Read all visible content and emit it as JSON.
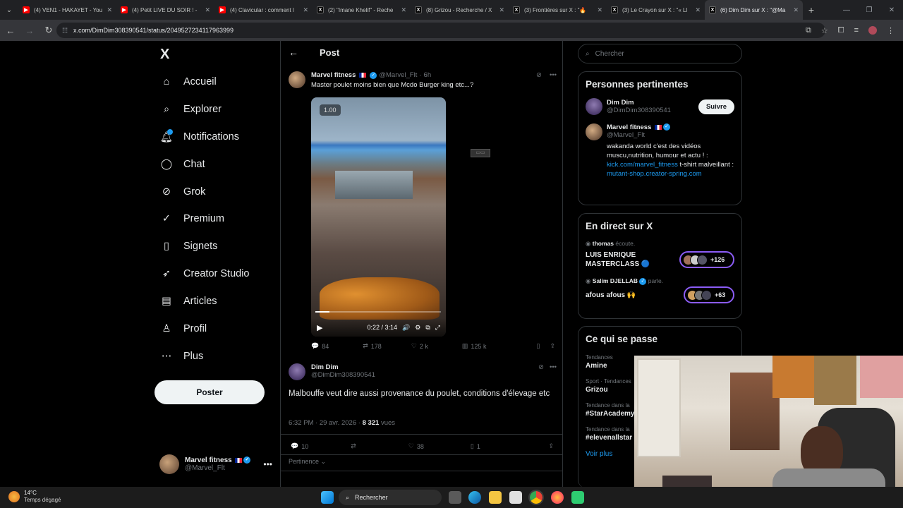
{
  "browser": {
    "tabs": [
      {
        "title": "(4) VEN1 - HAKAYET - You",
        "icon": "youtube",
        "color": "#ff0000"
      },
      {
        "title": "(4) Petit LIVE DU SOIR ! -",
        "icon": "youtube",
        "color": "#ff0000"
      },
      {
        "title": "(4) Clavicular : comment l",
        "icon": "youtube",
        "color": "#ff0000"
      },
      {
        "title": "(2) \"Imane Khelif\" - Reche",
        "icon": "x",
        "color": "#000000"
      },
      {
        "title": "(8) Grizou - Recherche / X",
        "icon": "x",
        "color": "#000000"
      },
      {
        "title": "(3) Frontières sur X : \"🔥",
        "icon": "x",
        "color": "#000000"
      },
      {
        "title": "(3) Le Crayon sur X : \"« Ll",
        "icon": "x",
        "color": "#000000"
      },
      {
        "title": "(6) Dim Dim sur X : \"@Ma",
        "icon": "x",
        "color": "#000000",
        "active": true
      }
    ],
    "url": "x.com/DimDim308390541/status/2049527234117963999"
  },
  "nav": {
    "logo": "X",
    "items": [
      {
        "label": "Accueil",
        "icon": "home-icon"
      },
      {
        "label": "Explorer",
        "icon": "search-icon"
      },
      {
        "label": "Notifications",
        "icon": "bell-icon"
      },
      {
        "label": "Chat",
        "icon": "chat-icon"
      },
      {
        "label": "Grok",
        "icon": "grok-icon"
      },
      {
        "label": "Premium",
        "icon": "premium-icon"
      },
      {
        "label": "Signets",
        "icon": "bookmark-icon"
      },
      {
        "label": "Creator Studio",
        "icon": "rocket-icon"
      },
      {
        "label": "Articles",
        "icon": "article-icon"
      },
      {
        "label": "Profil",
        "icon": "person-icon"
      },
      {
        "label": "Plus",
        "icon": "more-icon"
      }
    ],
    "post_label": "Poster",
    "account": {
      "name": "Marvel fitness",
      "handle": "@Marvel_Flt"
    }
  },
  "main": {
    "header": "Post",
    "quoted": {
      "name": "Marvel fitness",
      "handle": "@Marvel_Flt",
      "time": "6h",
      "text": "Master poulet moins bien que Mcdo Burger king etc...?",
      "video": {
        "speed": "1.00",
        "time": "0:22 / 3:14",
        "progress": 0.11
      },
      "stats": {
        "replies": "84",
        "reposts": "178",
        "likes": "2 k",
        "views": "125 k"
      }
    },
    "post": {
      "name": "Dim Dim",
      "handle": "@DimDim308390541",
      "text": "Malbouffe veut dire aussi provenance du poulet, conditions d'élevage etc",
      "timestamp": "6:32 PM · 29 avr. 2026 · ",
      "views_count": "8 321",
      "views_label": " vues",
      "stats": {
        "replies": "10",
        "reposts": "",
        "likes": "38",
        "bookmarks": "1"
      }
    },
    "sort_label": "Pertinence"
  },
  "right": {
    "search_placeholder": "Chercher",
    "people": {
      "title": "Personnes pertinentes",
      "p1": {
        "name": "Dim Dim",
        "handle": "@DimDim308390541",
        "follow": "Suivre"
      },
      "p2": {
        "name": "Marvel fitness",
        "handle": "@Marvel_Flt",
        "bio1": "wakanda world c'est des vidéos muscu,nutrition, humour et actu ! : ",
        "link1": "kick.com/marvel_fitness",
        "bio2": " t-shirt malveillant : ",
        "link2": "mutant-shop.creator-spring.com"
      }
    },
    "live": {
      "title": "En direct sur X",
      "s1": {
        "host": "thomas",
        "verb": "écoute.",
        "title": "LUIS ENRIQUE MASTERCLASS 🔵",
        "count": "+126"
      },
      "s2": {
        "host": "Salim DJELLAB",
        "verb": "parle.",
        "title": "afous afous 🙌",
        "count": "+63"
      }
    },
    "trends": {
      "title": "Ce qui se passe",
      "items": [
        {
          "meta": "Tendances",
          "name": "Amine"
        },
        {
          "meta": "Sport · Tendances",
          "name": "Grizou"
        },
        {
          "meta": "Tendance dans la",
          "name": "#StarAcademy"
        },
        {
          "meta": "Tendance dans la",
          "name": "#elevenallstar"
        }
      ],
      "more": "Voir plus"
    }
  },
  "taskbar": {
    "weather_temp": "14°C",
    "weather_desc": "Temps dégagé",
    "search": "Rechercher"
  }
}
